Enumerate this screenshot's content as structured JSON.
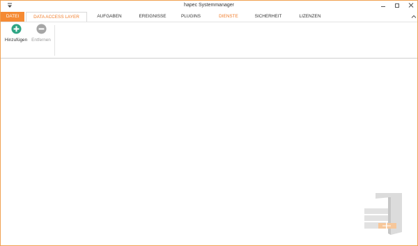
{
  "window": {
    "title": "hapec Systemmanager"
  },
  "ribbon": {
    "tabs": [
      {
        "label": "DATEI"
      },
      {
        "label": "DATA ACCESS LAYER"
      },
      {
        "label": "AUFGABEN"
      },
      {
        "label": "EREIGNISSE"
      },
      {
        "label": "PLUGINS"
      },
      {
        "label": "DIENSTE"
      },
      {
        "label": "SICHERHEIT"
      },
      {
        "label": "LIZENZEN"
      }
    ],
    "active_tab": "DATA ACCESS LAYER",
    "buttons": {
      "add": {
        "label": "Hinzufügen",
        "icon": "plus-circle-icon",
        "color": "#2ea584"
      },
      "remove": {
        "label": "Entfernen",
        "icon": "minus-circle-icon",
        "enabled": false,
        "color": "#a6a6a6"
      }
    }
  },
  "colors": {
    "accent": "#f58a33",
    "border": "#f0a050"
  }
}
